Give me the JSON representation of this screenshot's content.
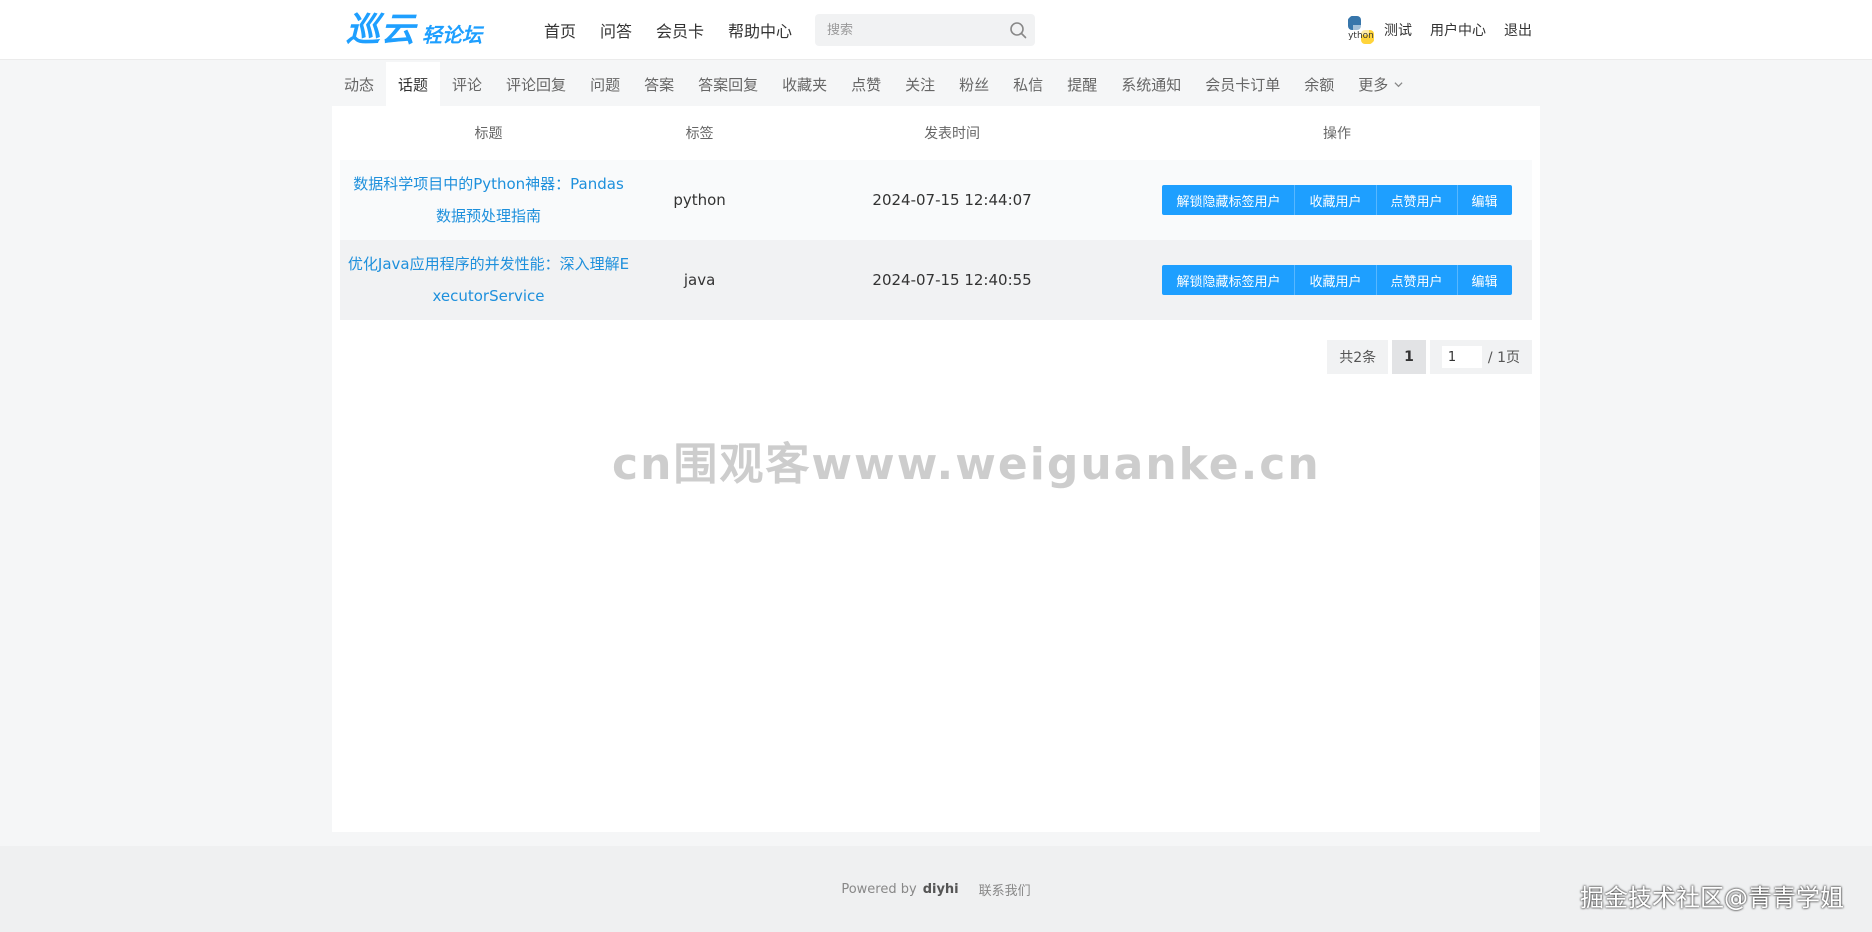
{
  "header": {
    "logo_main": "巡云",
    "logo_sub": "轻论坛",
    "nav": [
      "首页",
      "问答",
      "会员卡",
      "帮助中心"
    ],
    "search_placeholder": "搜索",
    "user": {
      "avatar_text": "ython",
      "name": "测试",
      "center": "用户中心",
      "logout": "退出"
    }
  },
  "subnav": {
    "tabs": [
      "动态",
      "话题",
      "评论",
      "评论回复",
      "问题",
      "答案",
      "答案回复",
      "收藏夹",
      "点赞",
      "关注",
      "粉丝",
      "私信",
      "提醒",
      "系统通知",
      "会员卡订单",
      "余额",
      "更多"
    ],
    "active_index": 1
  },
  "table": {
    "headers": [
      "标题",
      "标签",
      "发表时间",
      "操作"
    ],
    "rows": [
      {
        "title": "数据科学项目中的Python神器：Pandas数据预处理指南",
        "tag": "python",
        "time": "2024-07-15 12:44:07"
      },
      {
        "title": "优化Java应用程序的并发性能：深入理解ExecutorService",
        "tag": "java",
        "time": "2024-07-15 12:40:55"
      }
    ],
    "actions": [
      "解锁隐藏标签用户",
      "收藏用户",
      "点赞用户",
      "编辑"
    ]
  },
  "pager": {
    "total": "共2条",
    "current": "1",
    "jump_value": "1",
    "pages": "/ 1页"
  },
  "watermark": "cn围观客www.weiguanke.cn",
  "footer": {
    "powered": "Powered by",
    "brand": "diyhi",
    "contact": "联系我们"
  },
  "corner_mark": "掘金技术社区@青青学姐",
  "colors": {
    "accent": "#1e9fff",
    "link": "#1e90dc"
  }
}
